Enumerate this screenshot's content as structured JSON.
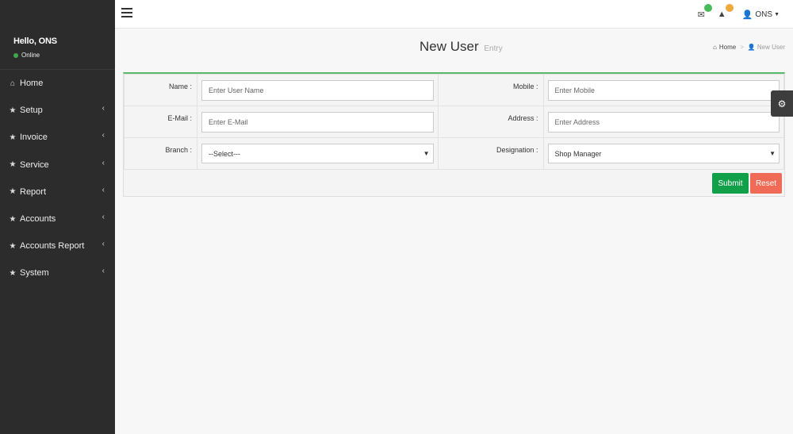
{
  "sidebar": {
    "greeting": "Hello, ONS",
    "status": "Online",
    "items": [
      {
        "label": "Home",
        "has_children": false
      },
      {
        "label": "Setup",
        "has_children": true
      },
      {
        "label": "Invoice",
        "has_children": true
      },
      {
        "label": "Service",
        "has_children": true
      },
      {
        "label": "Report",
        "has_children": true
      },
      {
        "label": "Accounts",
        "has_children": true
      },
      {
        "label": "Accounts Report",
        "has_children": true
      },
      {
        "label": "System",
        "has_children": true
      }
    ]
  },
  "topbar": {
    "user_label": "ONS",
    "icons": {
      "messages": "envelope-icon",
      "alerts": "warning-icon",
      "user": "user-icon"
    },
    "badge_colors": {
      "messages": "#48bb5a",
      "alerts": "#f1a83d"
    }
  },
  "header": {
    "title": "New User",
    "subtitle": "Entry",
    "breadcrumb": {
      "home": "Home",
      "current": "New User"
    }
  },
  "form": {
    "name_label": "Name :",
    "name_placeholder": "Enter User Name",
    "mobile_label": "Mobile :",
    "mobile_placeholder": "Enter Mobile",
    "email_label": "E-Mail :",
    "email_placeholder": "Enter E-Mail",
    "address_label": "Address :",
    "address_placeholder": "Enter Address",
    "branch_label": "Branch :",
    "branch_value": "--Select---",
    "designation_label": "Designation :",
    "designation_value": "Shop Manager",
    "submit_label": "Submit",
    "reset_label": "Reset"
  },
  "colors": {
    "sidebar_bg": "#2c2c2c",
    "accent_green": "#5cb86b",
    "submit": "#119f4a",
    "reset": "#f06b55"
  }
}
